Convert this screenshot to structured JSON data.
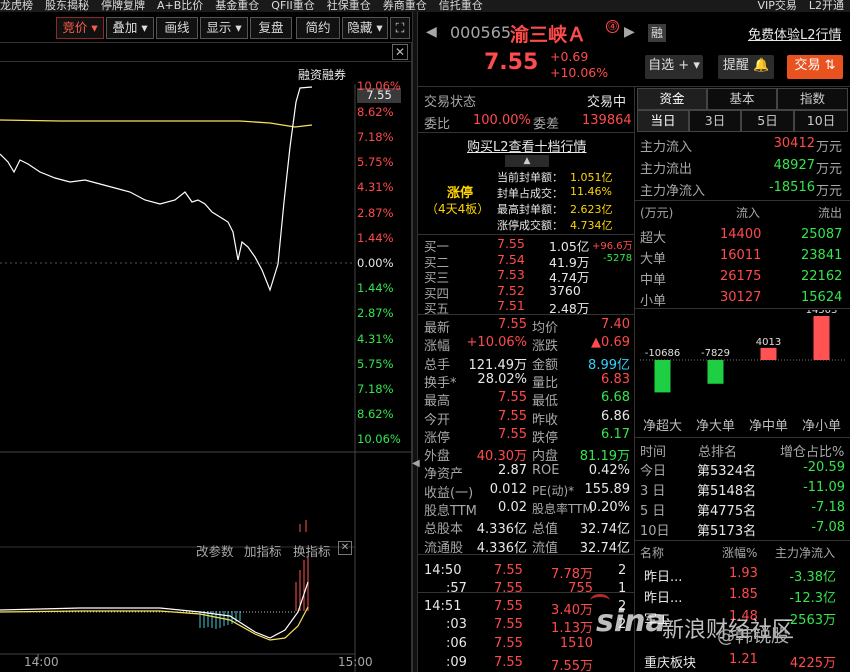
{
  "topmenu": {
    "items": [
      "龙虎榜",
      "股东揭秘",
      "停牌复牌",
      "A+B比价",
      "基金重仓",
      "QFII重仓",
      "社保重仓",
      "券商重仓",
      "信托重仓"
    ],
    "right": [
      "VIP交易",
      "L2开通"
    ]
  },
  "toolbar": {
    "jingjia": "竞价",
    "diejia": "叠加",
    "huaxian": "画线",
    "xianshi": "显示",
    "fupan": "复盘",
    "jianyue": "简约",
    "yincang": "隐藏"
  },
  "chart": {
    "tag": "融资融券",
    "price_marker": "7.55",
    "left_ticks": [
      "10.06%",
      "8.62%",
      "7.18%",
      "5.75%",
      "4.31%",
      "2.87%",
      "1.44%",
      "0.00%",
      "1.44%",
      "2.87%",
      "4.31%",
      "5.75%",
      "7.18%",
      "8.62%",
      "10.06%"
    ],
    "indicator_btns": [
      "改参数",
      "加指标",
      "换指标"
    ],
    "time_labels": [
      "14:00",
      "15:00"
    ]
  },
  "stock": {
    "code": "000565",
    "name": "渝三峡Ａ",
    "price": "7.55",
    "change": "+0.69",
    "change_pct": "+10.06%",
    "rong_badge": "融",
    "free_l2": "免费体验L2行情",
    "btn_zixuan": "自选",
    "btn_tixing": "提醒",
    "btn_jiaoyi": "交易"
  },
  "status": {
    "label": "交易状态",
    "value": "交易中",
    "weibi_label": "委比",
    "weibi": "100.00%",
    "weicha_label": "委差",
    "weicha": "139864",
    "buy_l2": "购买L2查看十档行情"
  },
  "limitup": {
    "title": "涨停",
    "sub": "（4天4板）",
    "lines": [
      {
        "label": "当前封单额：",
        "value": "1.051亿"
      },
      {
        "label": "封单占成交：",
        "value": "11.46%"
      },
      {
        "label": "最高封单额：",
        "value": "2.623亿"
      },
      {
        "label": "涨停成交额：",
        "value": "4.734亿"
      }
    ]
  },
  "bids": [
    {
      "label": "买一",
      "price": "7.55",
      "vol": "1.05亿",
      "chg": "+96.6万"
    },
    {
      "label": "买二",
      "price": "7.54",
      "vol": "41.9万",
      "chg": "-5278"
    },
    {
      "label": "买三",
      "price": "7.53",
      "vol": "4.74万",
      "chg": ""
    },
    {
      "label": "买四",
      "price": "7.52",
      "vol": "3760",
      "chg": ""
    },
    {
      "label": "买五",
      "price": "7.51",
      "vol": "2.48万",
      "chg": ""
    }
  ],
  "quote": [
    {
      "l1": "最新",
      "v1": "7.55",
      "c1": "red",
      "l2": "均价",
      "v2": "7.40",
      "c2": "red"
    },
    {
      "l1": "涨幅",
      "v1": "+10.06%",
      "c1": "red",
      "l2": "涨跌",
      "v2": "▲0.69",
      "c2": "red"
    },
    {
      "l1": "总手",
      "v1": "121.49万",
      "c1": "white",
      "l2": "金额",
      "v2": "8.99亿",
      "c2": "cyan"
    },
    {
      "l1": "换手*",
      "v1": "28.02%",
      "c1": "white",
      "l2": "量比",
      "v2": "6.83",
      "c2": "red"
    },
    {
      "l1": "最高",
      "v1": "7.55",
      "c1": "red",
      "l2": "最低",
      "v2": "6.68",
      "c2": "green"
    },
    {
      "l1": "今开",
      "v1": "7.55",
      "c1": "red",
      "l2": "昨收",
      "v2": "6.86",
      "c2": "white"
    },
    {
      "l1": "涨停",
      "v1": "7.55",
      "c1": "red",
      "l2": "跌停",
      "v2": "6.17",
      "c2": "green"
    },
    {
      "l1": "外盘",
      "v1": "40.30万",
      "c1": "red",
      "l2": "内盘",
      "v2": "81.19万",
      "c2": "green"
    },
    {
      "l1": "净资产",
      "v1": "2.87",
      "c1": "white",
      "l2": "ROE",
      "v2": "0.42%",
      "c2": "white"
    },
    {
      "l1": "收益(一)",
      "v1": "0.012",
      "c1": "white",
      "l2": "PE(动)*",
      "v2": "155.89",
      "c2": "white"
    },
    {
      "l1": "股息TTM",
      "v1": "0.02",
      "c1": "white",
      "l2": "股息率TTM",
      "v2": "0.20%",
      "c2": "white"
    },
    {
      "l1": "总股本",
      "v1": "4.336亿",
      "c1": "white",
      "l2": "总值",
      "v2": "32.74亿",
      "c2": "white"
    },
    {
      "l1": "流通股",
      "v1": "4.336亿",
      "c1": "white",
      "l2": "流值",
      "v2": "32.74亿",
      "c2": "white"
    }
  ],
  "ticks": [
    {
      "time": "14:50",
      "price": "7.55",
      "vol": "7.78万",
      "n": "2"
    },
    {
      "time": ":57",
      "price": "7.55",
      "vol": "755",
      "n": "1"
    },
    {
      "time": "14:51",
      "price": "7.55",
      "vol": "3.40万",
      "n": "2"
    },
    {
      "time": ":03",
      "price": "7.55",
      "vol": "1.13万",
      "n": "2"
    },
    {
      "time": ":06",
      "price": "7.55",
      "vol": "1510",
      "n": ""
    },
    {
      "time": ":09",
      "price": "7.55",
      "vol": "7.55万",
      "n": ""
    }
  ],
  "fund": {
    "tabs": [
      "资金",
      "基本",
      "指数"
    ],
    "periods": [
      "当日",
      "3日",
      "5日",
      "10日"
    ],
    "flows": [
      {
        "label": "主力流入",
        "value": "30412",
        "unit": "万元",
        "c": "red"
      },
      {
        "label": "主力流出",
        "value": "48927",
        "unit": "万元",
        "c": "green"
      },
      {
        "label": "主力净流入",
        "value": "-18516",
        "unit": "万元",
        "c": "green"
      }
    ],
    "table_head": [
      "(万元)",
      "流入",
      "流出"
    ],
    "table": [
      {
        "name": "超大",
        "in": "14400",
        "out": "25087"
      },
      {
        "name": "大单",
        "in": "16011",
        "out": "23841"
      },
      {
        "name": "中单",
        "in": "26175",
        "out": "22162"
      },
      {
        "name": "小单",
        "in": "30127",
        "out": "15624"
      }
    ],
    "net_bars": [
      {
        "label": "净超大",
        "value": -10686,
        "text": "-10686"
      },
      {
        "label": "净大单",
        "value": -7829,
        "text": "-7829"
      },
      {
        "label": "净中单",
        "value": 4013,
        "text": "4013"
      },
      {
        "label": "净小单",
        "value": 14503,
        "text": "14503"
      }
    ],
    "rank_head": [
      "时间",
      "总排名",
      "增仓占比%"
    ],
    "rank": [
      {
        "t": "今日",
        "r": "第5324名",
        "v": "-20.59"
      },
      {
        "t": "3 日",
        "r": "第5148名",
        "v": "-11.09"
      },
      {
        "t": "5 日",
        "r": "第4775名",
        "v": "-7.18"
      },
      {
        "t": "10日",
        "r": "第5173名",
        "v": "-7.08"
      }
    ],
    "sector_head": [
      "名称",
      "涨幅%",
      "主力净流入"
    ],
    "sectors": [
      {
        "name": "昨日...",
        "pct": "1.93",
        "net": "-3.38亿",
        "nc": "green"
      },
      {
        "name": "昨日...",
        "pct": "1.85",
        "net": "-12.3亿",
        "nc": "green"
      },
      {
        "name": "军工",
        "pct": "1.48",
        "net": "-2563万",
        "nc": "green"
      },
      {
        "name": "",
        "pct": "",
        "net": "",
        "nc": "green"
      },
      {
        "name": "重庆板块",
        "pct": "1.21",
        "net": "4225万",
        "nc": "red"
      }
    ]
  },
  "watermark": {
    "brand": "sina",
    "text": "新浪财经社区",
    "sub": "@韩锐股"
  }
}
